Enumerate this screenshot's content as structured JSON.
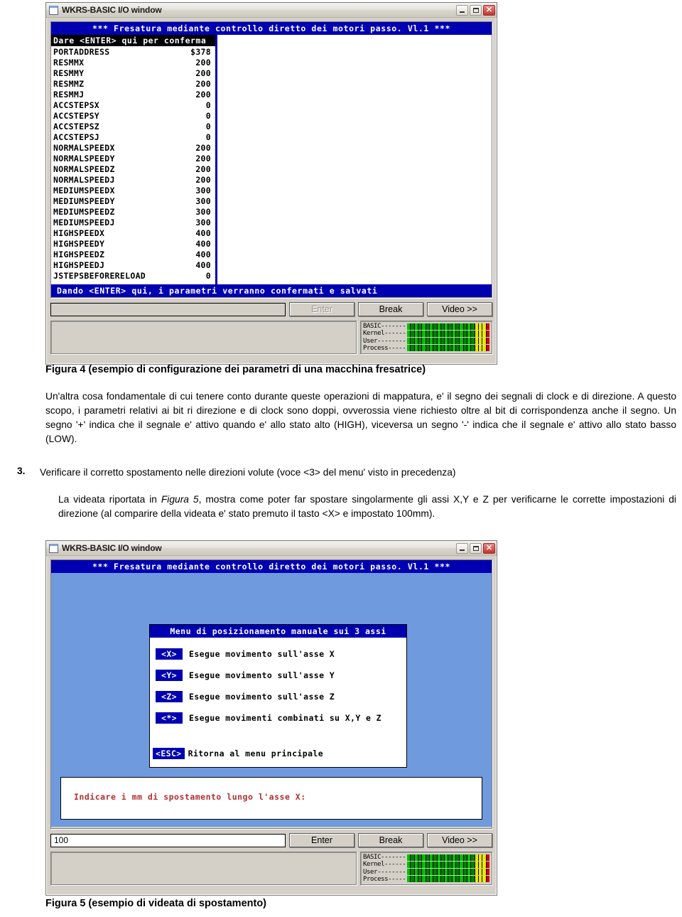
{
  "window1": {
    "title": "WKRS-BASIC I/O window",
    "titlebar_buttons": [
      "minimize-icon",
      "maximize-icon",
      "close-icon"
    ],
    "banner": "*** Fresatura mediante controllo diretto dei motori passo. Vl.1 ***",
    "param_header": "Dare <ENTER> qui per conferma",
    "params": [
      {
        "name": "PORTADDRESS",
        "value": "$378"
      },
      {
        "name": "RESMMX",
        "value": "200"
      },
      {
        "name": "RESMMY",
        "value": "200"
      },
      {
        "name": "RESMMZ",
        "value": "200"
      },
      {
        "name": "RESMMJ",
        "value": "200"
      },
      {
        "name": "ACCSTEPSX",
        "value": "0"
      },
      {
        "name": "ACCSTEPSY",
        "value": "0"
      },
      {
        "name": "ACCSTEPSZ",
        "value": "0"
      },
      {
        "name": "ACCSTEPSJ",
        "value": "0"
      },
      {
        "name": "NORMALSPEEDX",
        "value": "200"
      },
      {
        "name": "NORMALSPEEDY",
        "value": "200"
      },
      {
        "name": "NORMALSPEEDZ",
        "value": "200"
      },
      {
        "name": "NORMALSPEEDJ",
        "value": "200"
      },
      {
        "name": "MEDIUMSPEEDX",
        "value": "300"
      },
      {
        "name": "MEDIUMSPEEDY",
        "value": "300"
      },
      {
        "name": "MEDIUMSPEEDZ",
        "value": "300"
      },
      {
        "name": "MEDIUMSPEEDJ",
        "value": "300"
      },
      {
        "name": "HIGHSPEEDX",
        "value": "400"
      },
      {
        "name": "HIGHSPEEDY",
        "value": "400"
      },
      {
        "name": "HIGHSPEEDZ",
        "value": "400"
      },
      {
        "name": "HIGHSPEEDJ",
        "value": "400"
      },
      {
        "name": "JSTEPSBEFORERELOAD",
        "value": "0"
      }
    ],
    "footer": "Dando <ENTER> qui, i parametri verranno confermati e salvati",
    "input_value": "",
    "buttons": {
      "enter": "Enter",
      "break": "Break",
      "video": "Video >>"
    },
    "meters": [
      {
        "label": "BASIC-------",
        "value": 100
      },
      {
        "label": "Kernel--------",
        "value": 100
      },
      {
        "label": "User----------",
        "value": 100
      },
      {
        "label": "Process------",
        "value": 100
      }
    ]
  },
  "window2": {
    "title": "WKRS-BASIC I/O window",
    "banner": "*** Fresatura mediante controllo diretto dei motori passo. Vl.1 ***",
    "menu_title": "Menu di posizionamento manuale sui 3 assi",
    "menu_items": [
      {
        "key": "<X>",
        "label": "Esegue movimento sull'asse X"
      },
      {
        "key": "<Y>",
        "label": "Esegue movimento sull'asse Y"
      },
      {
        "key": "<Z>",
        "label": "Esegue movimento sull'asse Z"
      },
      {
        "key": "<*>",
        "label": "Esegue movimenti combinati su X,Y e Z"
      }
    ],
    "escape_item": {
      "key": "<ESC>",
      "label": "Ritorna al menu principale"
    },
    "prompt": "Indicare i mm di spostamento lungo l'asse X:",
    "input_value": "100",
    "buttons": {
      "enter": "Enter",
      "break": "Break",
      "video": "Video >>"
    },
    "meters": [
      {
        "label": "BASIC-------",
        "value": 100
      },
      {
        "label": "Kernel--------",
        "value": 100
      },
      {
        "label": "User----------",
        "value": 100
      },
      {
        "label": "Process------",
        "value": 100
      }
    ]
  },
  "document": {
    "caption_fig4": "Figura 4 (esempio di configurazione dei parametri di una macchina fresatrice)",
    "paragraph1": "Un'altra cosa fondamentale di cui tenere conto durante queste operazioni di mappatura, e' il segno dei segnali di clock e di direzione. A questo scopo, i parametri relativi ai bit ri direzione e di clock sono doppi, ovverossia viene richiesto oltre al bit di corrispondenza anche il segno. Un segno '+' indica che il segnale e' attivo quando e' allo stato alto (HIGH), viceversa un segno '-' indica che il segnale e' attivo allo stato basso (LOW).",
    "item3_number": "3.",
    "item3_text": "Verificare il corretto spostamento nelle direzioni volute (voce <3> del menu' visto in precedenza)",
    "paragraph2_before": "La videata riportata in ",
    "paragraph2_italic": "Figura 5",
    "paragraph2_after": ", mostra come poter far spostare singolarmente gli assi X,Y e Z per verificarne le corrette impostazioni di direzione (al comparire della videata e' stato premuto il tasto <X> e impostato 100mm).",
    "caption_fig5": "Figura 5 (esempio di videata di spostamento)"
  },
  "colors": {
    "terminal_blue": "#0000b0",
    "window_chrome": "#d4d0c8",
    "desktop_blue": "#6f9ade",
    "prompt_red": "#b03030",
    "meter_green": "#00a000",
    "meter_yellow": "#e8e800",
    "meter_red": "#d00000"
  }
}
